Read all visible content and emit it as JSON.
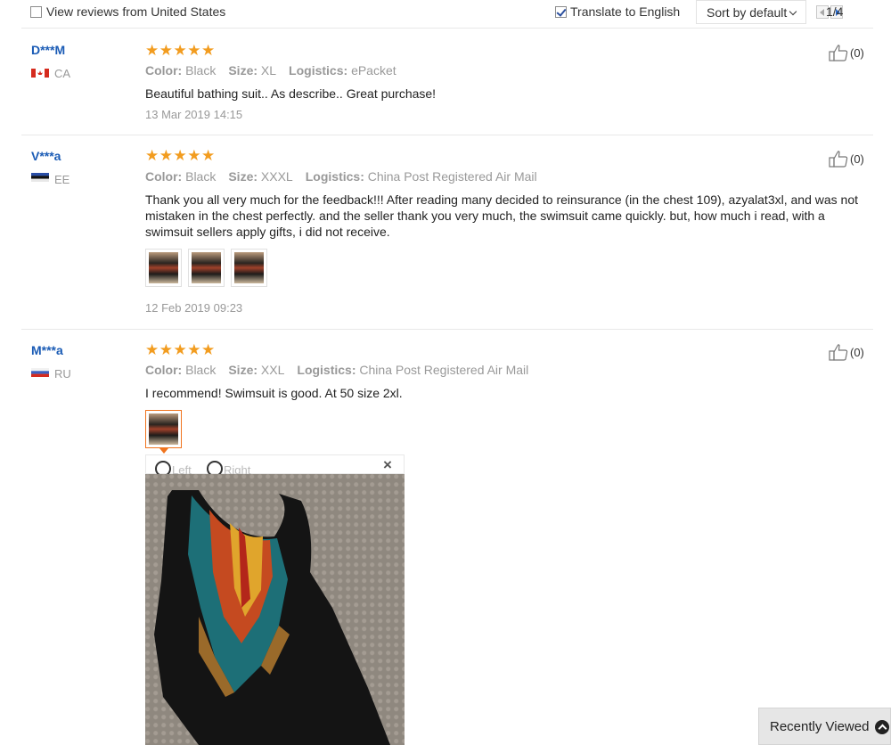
{
  "filters": {
    "view_us_label": "View reviews from United States",
    "view_us_checked": false,
    "translate_label": "Translate to English",
    "translate_checked": true,
    "sort_label": "Sort by default",
    "page_indicator": "1/4"
  },
  "attr_labels": {
    "color": "Color:",
    "size": "Size:",
    "logistics": "Logistics:"
  },
  "reviews": [
    {
      "user": "D***M",
      "country": "CA",
      "rating": 5,
      "stars": "★★★★★",
      "color": "Black",
      "size": "XL",
      "logistics": "ePacket",
      "text": "Beautiful bathing suit.. As describe.. Great purchase!",
      "date": "13 Mar 2019 14:15",
      "likes": "(0)"
    },
    {
      "user": "V***a",
      "country": "EE",
      "rating": 5,
      "stars": "★★★★★",
      "color": "Black",
      "size": "XXXL",
      "logistics": "China Post Registered Air Mail",
      "text": "Thank you all very much for the feedback!!! After reading many decided to reinsurance (in the chest 109), azyalat3xl, and was not mistaken in the chest perfectly. and the seller thank you very much, the swimsuit came quickly. but, how much i read, with a swimsuit sellers apply gifts, i did not receive.",
      "date": "12 Feb 2019 09:23",
      "likes": "(0)"
    },
    {
      "user": "M***a",
      "country": "RU",
      "rating": 5,
      "stars": "★★★★★",
      "color": "Black",
      "size": "XXL",
      "logistics": "China Post Registered Air Mail",
      "text": "I recommend! Swimsuit is good. At 50 size 2xl.",
      "likes": "(0)"
    }
  ],
  "viewer": {
    "rotate_left": "Left",
    "rotate_right": "Right",
    "close": "×"
  },
  "recently_viewed": "Recently Viewed"
}
